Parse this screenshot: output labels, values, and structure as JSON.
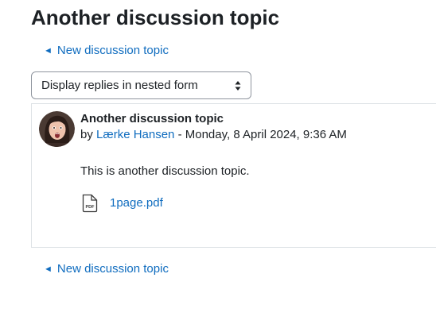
{
  "page": {
    "title": "Another discussion topic"
  },
  "nav": {
    "arrow": "◄",
    "top_link_label": "New discussion topic",
    "bottom_link_label": "New discussion topic"
  },
  "display_mode": {
    "selected": "Display replies in nested form"
  },
  "post": {
    "subject": "Another discussion topic",
    "by_prefix": "by",
    "author": "Lærke Hansen",
    "separator": "-",
    "date": "Monday, 8 April 2024, 9:36 AM",
    "message": "This is another discussion topic.",
    "attachment": {
      "icon": "pdf-file-icon",
      "icon_text": "PDF",
      "filename": "1page.pdf"
    }
  },
  "colors": {
    "link": "#0f6cbf",
    "text": "#1d2125",
    "border": "#dee2e6"
  }
}
